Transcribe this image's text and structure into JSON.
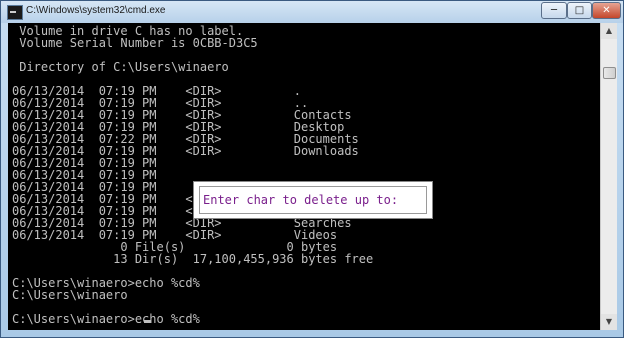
{
  "window": {
    "title": "C:\\Windows\\system32\\cmd.exe",
    "buttons": {
      "minimize": "─",
      "maximize": "□",
      "close": "✕"
    }
  },
  "console": {
    "text": " Volume in drive C has no label.\n Volume Serial Number is 0CBB-D3C5\n\n Directory of C:\\Users\\winaero\n\n06/13/2014  07:19 PM    <DIR>          .\n06/13/2014  07:19 PM    <DIR>          ..\n06/13/2014  07:19 PM    <DIR>          Contacts\n06/13/2014  07:19 PM    <DIR>          Desktop\n06/13/2014  07:22 PM    <DIR>          Documents\n06/13/2014  07:19 PM    <DIR>          Downloads\n06/13/2014  07:19 PM\n06/13/2014  07:19 PM\n06/13/2014  07:19 PM\n06/13/2014  07:19 PM    <DIR>          Pictures\n06/13/2014  07:19 PM    <DIR>          Saved Games\n06/13/2014  07:19 PM    <DIR>          Searches\n06/13/2014  07:19 PM    <DIR>          Videos\n               0 File(s)              0 bytes\n              13 Dir(s)  17,100,455,936 bytes free\n\nC:\\Users\\winaero>echo %cd%\nC:\\Users\\winaero\n\nC:\\Users\\winaero>echo %cd%"
  },
  "popup": {
    "prompt": "Enter char to delete up to:"
  },
  "scrollbar": {
    "up": "▲",
    "down": "▼"
  }
}
